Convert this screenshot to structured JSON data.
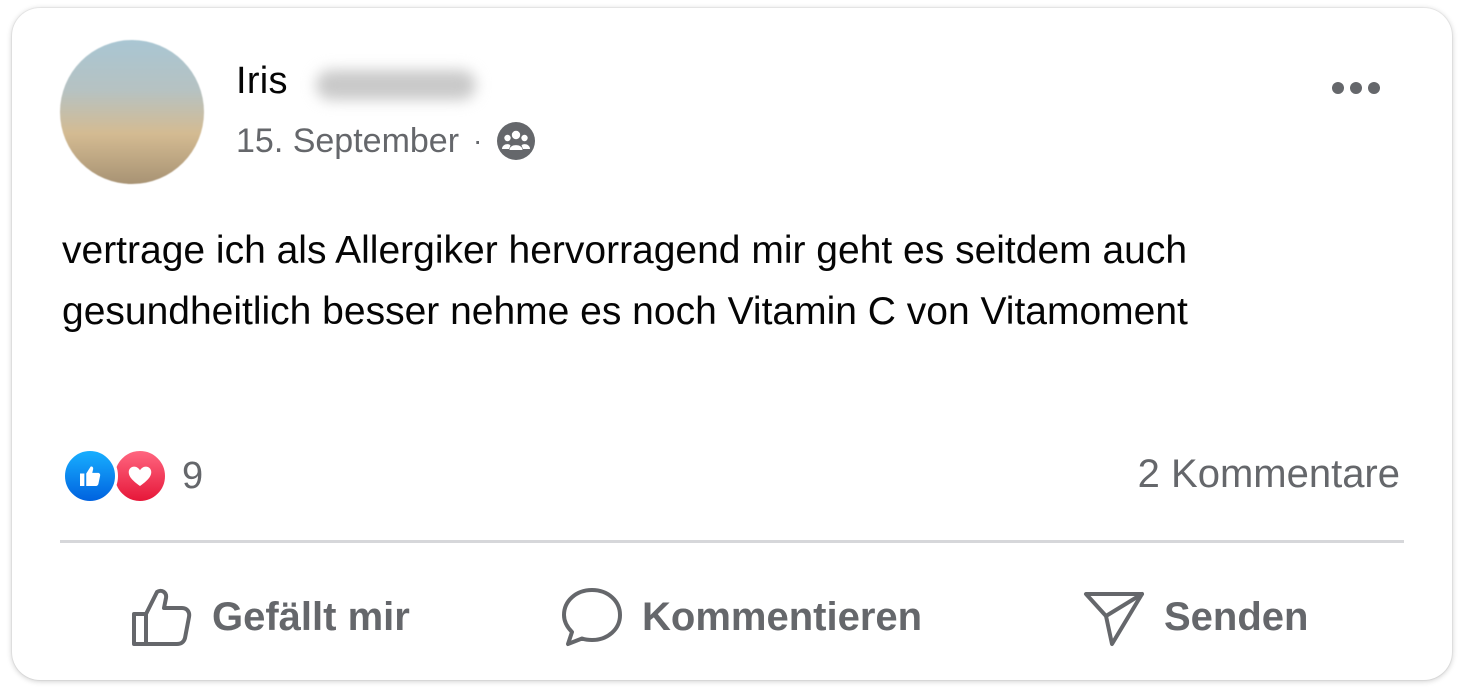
{
  "post": {
    "author_name": "Iris",
    "date": "15. September",
    "separator": "·",
    "audience_icon": "group-icon",
    "text": "vertrage ich als Allergiker hervorragend mir geht es seitdem auch gesundheitlich besser nehme es noch Vitamin C von Vitamoment"
  },
  "reactions": {
    "icons": [
      "like-reaction-icon",
      "love-reaction-icon"
    ],
    "count": "9",
    "comments_label": "2 Kommentare"
  },
  "actions": {
    "like_label": "Gefällt mir",
    "comment_label": "Kommentieren",
    "send_label": "Senden"
  },
  "colors": {
    "like_blue": "#0866ff",
    "love_red": "#f33e58",
    "secondary_text": "#65676b",
    "primary_text": "#050505"
  }
}
